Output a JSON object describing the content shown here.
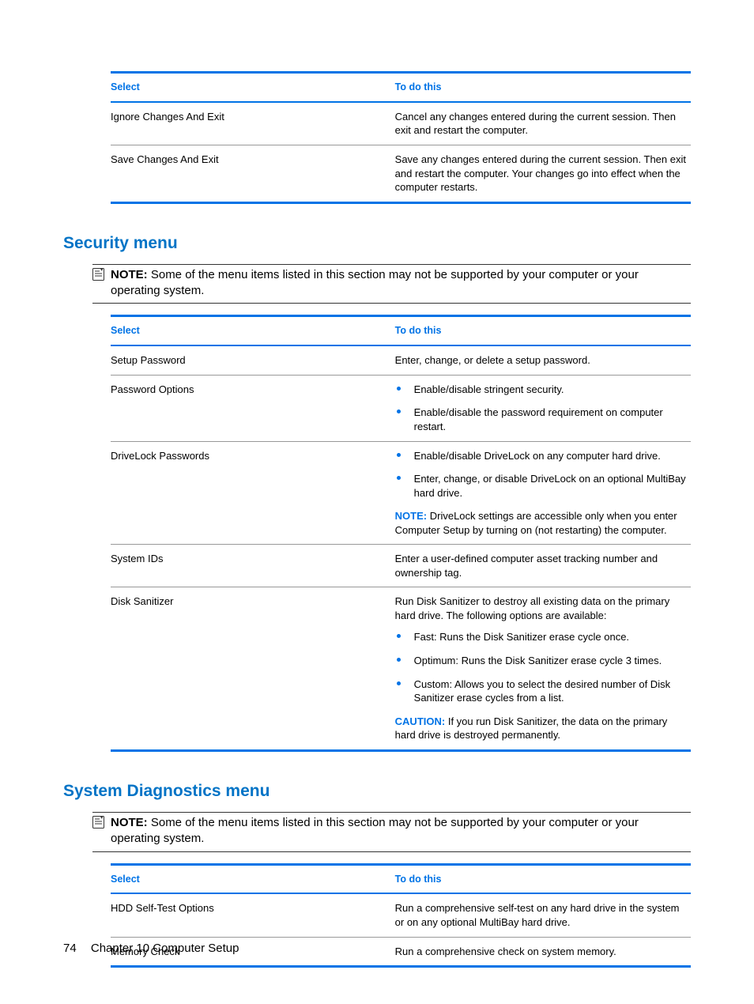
{
  "tables": {
    "exit": {
      "headers": {
        "select": "Select",
        "todo": "To do this"
      },
      "rows": [
        {
          "select": "Ignore Changes And Exit",
          "todo": "Cancel any changes entered during the current session. Then exit and restart the computer."
        },
        {
          "select": "Save Changes And Exit",
          "todo": "Save any changes entered during the current session. Then exit and restart the computer. Your changes go into effect when the computer restarts."
        }
      ]
    },
    "security": {
      "headers": {
        "select": "Select",
        "todo": "To do this"
      },
      "rows": {
        "setup_password": {
          "select": "Setup Password",
          "todo": "Enter, change, or delete a setup password."
        },
        "password_options": {
          "select": "Password Options",
          "bullets": [
            "Enable/disable stringent security.",
            "Enable/disable the password requirement on computer restart."
          ]
        },
        "drivelock": {
          "select": "DriveLock Passwords",
          "bullets": [
            "Enable/disable DriveLock on any computer hard drive.",
            "Enter, change, or disable DriveLock on an optional MultiBay hard drive."
          ],
          "note_label": "NOTE:",
          "note_text": "DriveLock settings are accessible only when you enter Computer Setup by turning on (not restarting) the computer."
        },
        "system_ids": {
          "select": "System IDs",
          "todo": "Enter a user-defined computer asset tracking number and ownership tag."
        },
        "disk_sanitizer": {
          "select": "Disk Sanitizer",
          "intro": "Run Disk Sanitizer to destroy all existing data on the primary hard drive. The following options are available:",
          "bullets": [
            "Fast: Runs the Disk Sanitizer erase cycle once.",
            "Optimum: Runs the Disk Sanitizer erase cycle 3 times.",
            "Custom: Allows you to select the desired number of Disk Sanitizer erase cycles from a list."
          ],
          "caution_label": "CAUTION:",
          "caution_text": "If you run Disk Sanitizer, the data on the primary hard drive is destroyed permanently."
        }
      }
    },
    "diagnostics": {
      "headers": {
        "select": "Select",
        "todo": "To do this"
      },
      "rows": [
        {
          "select": "HDD Self-Test Options",
          "todo": "Run a comprehensive self-test on any hard drive in the system or on any optional MultiBay hard drive."
        },
        {
          "select": "Memory Check",
          "todo": "Run a comprehensive check on system memory."
        }
      ]
    }
  },
  "headings": {
    "security": "Security menu",
    "diagnostics": "System Diagnostics menu"
  },
  "notes": {
    "generic_label": "NOTE:",
    "generic_text": "Some of the menu items listed in this section may not be supported by your computer or your operating system."
  },
  "footer": {
    "page": "74",
    "chapter": "Chapter 10   Computer Setup"
  }
}
